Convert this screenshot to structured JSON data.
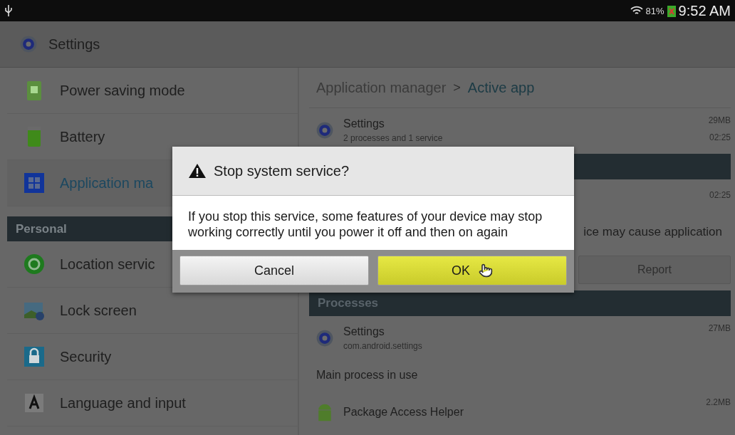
{
  "status_bar": {
    "battery": "81%",
    "time": "9:52 AM"
  },
  "app_bar": {
    "title": "Settings"
  },
  "sidebar": {
    "items": [
      {
        "kind": "item",
        "label": "Power saving mode",
        "selected": false
      },
      {
        "kind": "item",
        "label": "Battery",
        "selected": false
      },
      {
        "kind": "item",
        "label": "Application ma",
        "selected": true
      },
      {
        "kind": "header",
        "label": "Personal"
      },
      {
        "kind": "item",
        "label": "Location servic",
        "selected": false
      },
      {
        "kind": "item",
        "label": "Lock screen",
        "selected": false
      },
      {
        "kind": "item",
        "label": "Security",
        "selected": false
      },
      {
        "kind": "item",
        "label": "Language and input",
        "selected": false
      }
    ]
  },
  "detail": {
    "breadcrumb": {
      "parent": "Application manager",
      "separator": ">",
      "current": "Active app"
    },
    "items": [
      {
        "kind": "app",
        "name": "Settings",
        "subtitle": "2 processes and 1 service",
        "size": "29MB",
        "time": "02:25"
      },
      {
        "kind": "header"
      },
      {
        "kind": "time",
        "time": "02:25"
      },
      {
        "kind": "note",
        "text": "ice may cause application"
      },
      {
        "kind": "button",
        "label": "Report",
        "disabled": true
      },
      {
        "kind": "header",
        "label": "Processes"
      },
      {
        "kind": "app",
        "name": "Settings",
        "subtitle": "com.android.settings",
        "size": "27MB"
      },
      {
        "kind": "text",
        "text": "Main process in use"
      },
      {
        "kind": "app",
        "name": "Package Access Helper",
        "size": "2.2MB"
      }
    ]
  },
  "dialog": {
    "title": "Stop system service?",
    "message": "If you stop this service, some features of your device may stop working correctly until you power it off and then on again",
    "buttons": [
      {
        "label": "Cancel",
        "selected": false
      },
      {
        "label": "OK",
        "selected": true
      }
    ]
  }
}
